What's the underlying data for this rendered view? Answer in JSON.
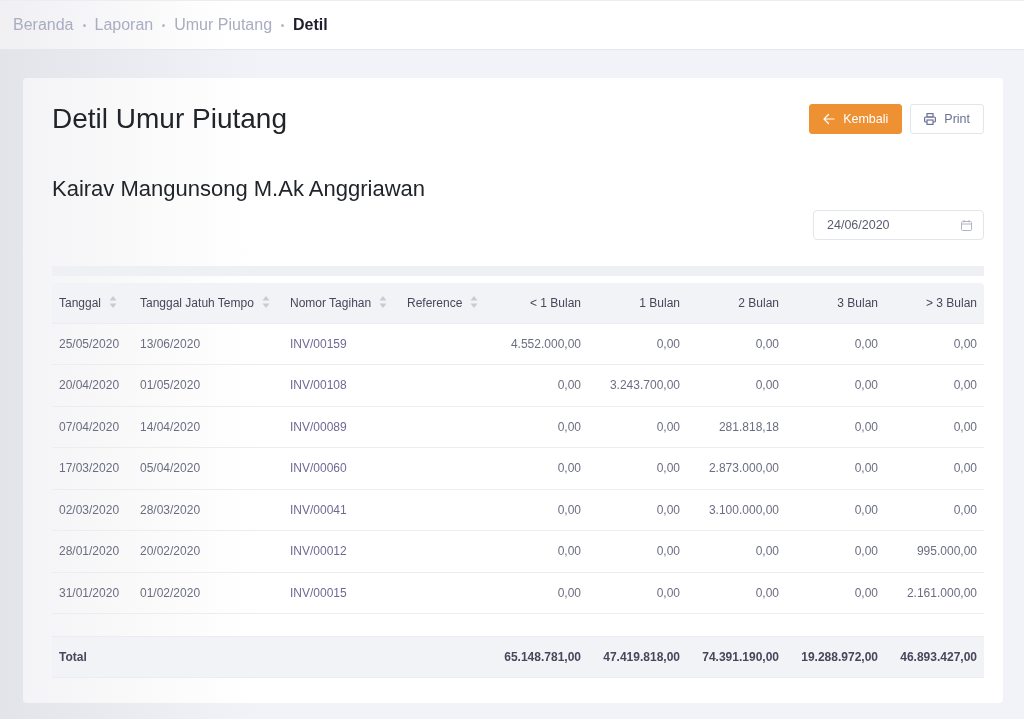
{
  "breadcrumb": [
    {
      "label": "Beranda",
      "current": false
    },
    {
      "label": "Laporan",
      "current": false
    },
    {
      "label": "Umur Piutang",
      "current": false
    },
    {
      "label": "Detil",
      "current": true
    }
  ],
  "page_title": "Detil Umur Piutang",
  "buttons": [
    {
      "kind": "back",
      "label": "Kembali"
    },
    {
      "kind": "print",
      "label": "Print"
    }
  ],
  "customer_name": "Kairav Mangunsong M.Ak Anggriawan",
  "date_field": {
    "value": "24/06/2020"
  },
  "table": {
    "columns": [
      {
        "label": "Tanggal",
        "kind": "text",
        "sortable": true
      },
      {
        "label": "Tanggal Jatuh Tempo",
        "kind": "text",
        "sortable": true
      },
      {
        "label": "Nomor Tagihan",
        "kind": "text",
        "sortable": true
      },
      {
        "label": "Reference",
        "kind": "text",
        "sortable": true
      },
      {
        "label": "< 1 Bulan",
        "kind": "amount",
        "sortable": false
      },
      {
        "label": "1 Bulan",
        "kind": "amount",
        "sortable": false
      },
      {
        "label": "2 Bulan",
        "kind": "amount",
        "sortable": false
      },
      {
        "label": "3 Bulan",
        "kind": "amount",
        "sortable": false
      },
      {
        "label": "> 3 Bulan",
        "kind": "amount",
        "sortable": false
      }
    ],
    "rows": [
      {
        "date": "25/05/2020",
        "due_date": "13/06/2020",
        "invoice_no": "INV/00159",
        "amounts": [
          "4.552.000,00",
          "0,00",
          "0,00",
          "0,00",
          "0,00"
        ]
      },
      {
        "date": "20/04/2020",
        "due_date": "01/05/2020",
        "invoice_no": "INV/00108",
        "amounts": [
          "0,00",
          "3.243.700,00",
          "0,00",
          "0,00",
          "0,00"
        ]
      },
      {
        "date": "07/04/2020",
        "due_date": "14/04/2020",
        "invoice_no": "INV/00089",
        "amounts": [
          "0,00",
          "0,00",
          "281.818,18",
          "0,00",
          "0,00"
        ]
      },
      {
        "date": "17/03/2020",
        "due_date": "05/04/2020",
        "invoice_no": "INV/00060",
        "amounts": [
          "0,00",
          "0,00",
          "2.873.000,00",
          "0,00",
          "0,00"
        ]
      },
      {
        "date": "02/03/2020",
        "due_date": "28/03/2020",
        "invoice_no": "INV/00041",
        "amounts": [
          "0,00",
          "0,00",
          "3.100.000,00",
          "0,00",
          "0,00"
        ]
      },
      {
        "date": "28/01/2020",
        "due_date": "20/02/2020",
        "invoice_no": "INV/00012",
        "amounts": [
          "0,00",
          "0,00",
          "0,00",
          "0,00",
          "995.000,00"
        ]
      },
      {
        "date": "31/01/2020",
        "due_date": "01/02/2020",
        "invoice_no": "INV/00015",
        "amounts": [
          "0,00",
          "0,00",
          "0,00",
          "0,00",
          "2.161.000,00"
        ]
      }
    ],
    "total": {
      "label": "Total",
      "amounts": [
        "65.148.781,00",
        "47.419.818,00",
        "74.391.190,00",
        "19.288.972,00",
        "46.893.427,00"
      ]
    }
  }
}
